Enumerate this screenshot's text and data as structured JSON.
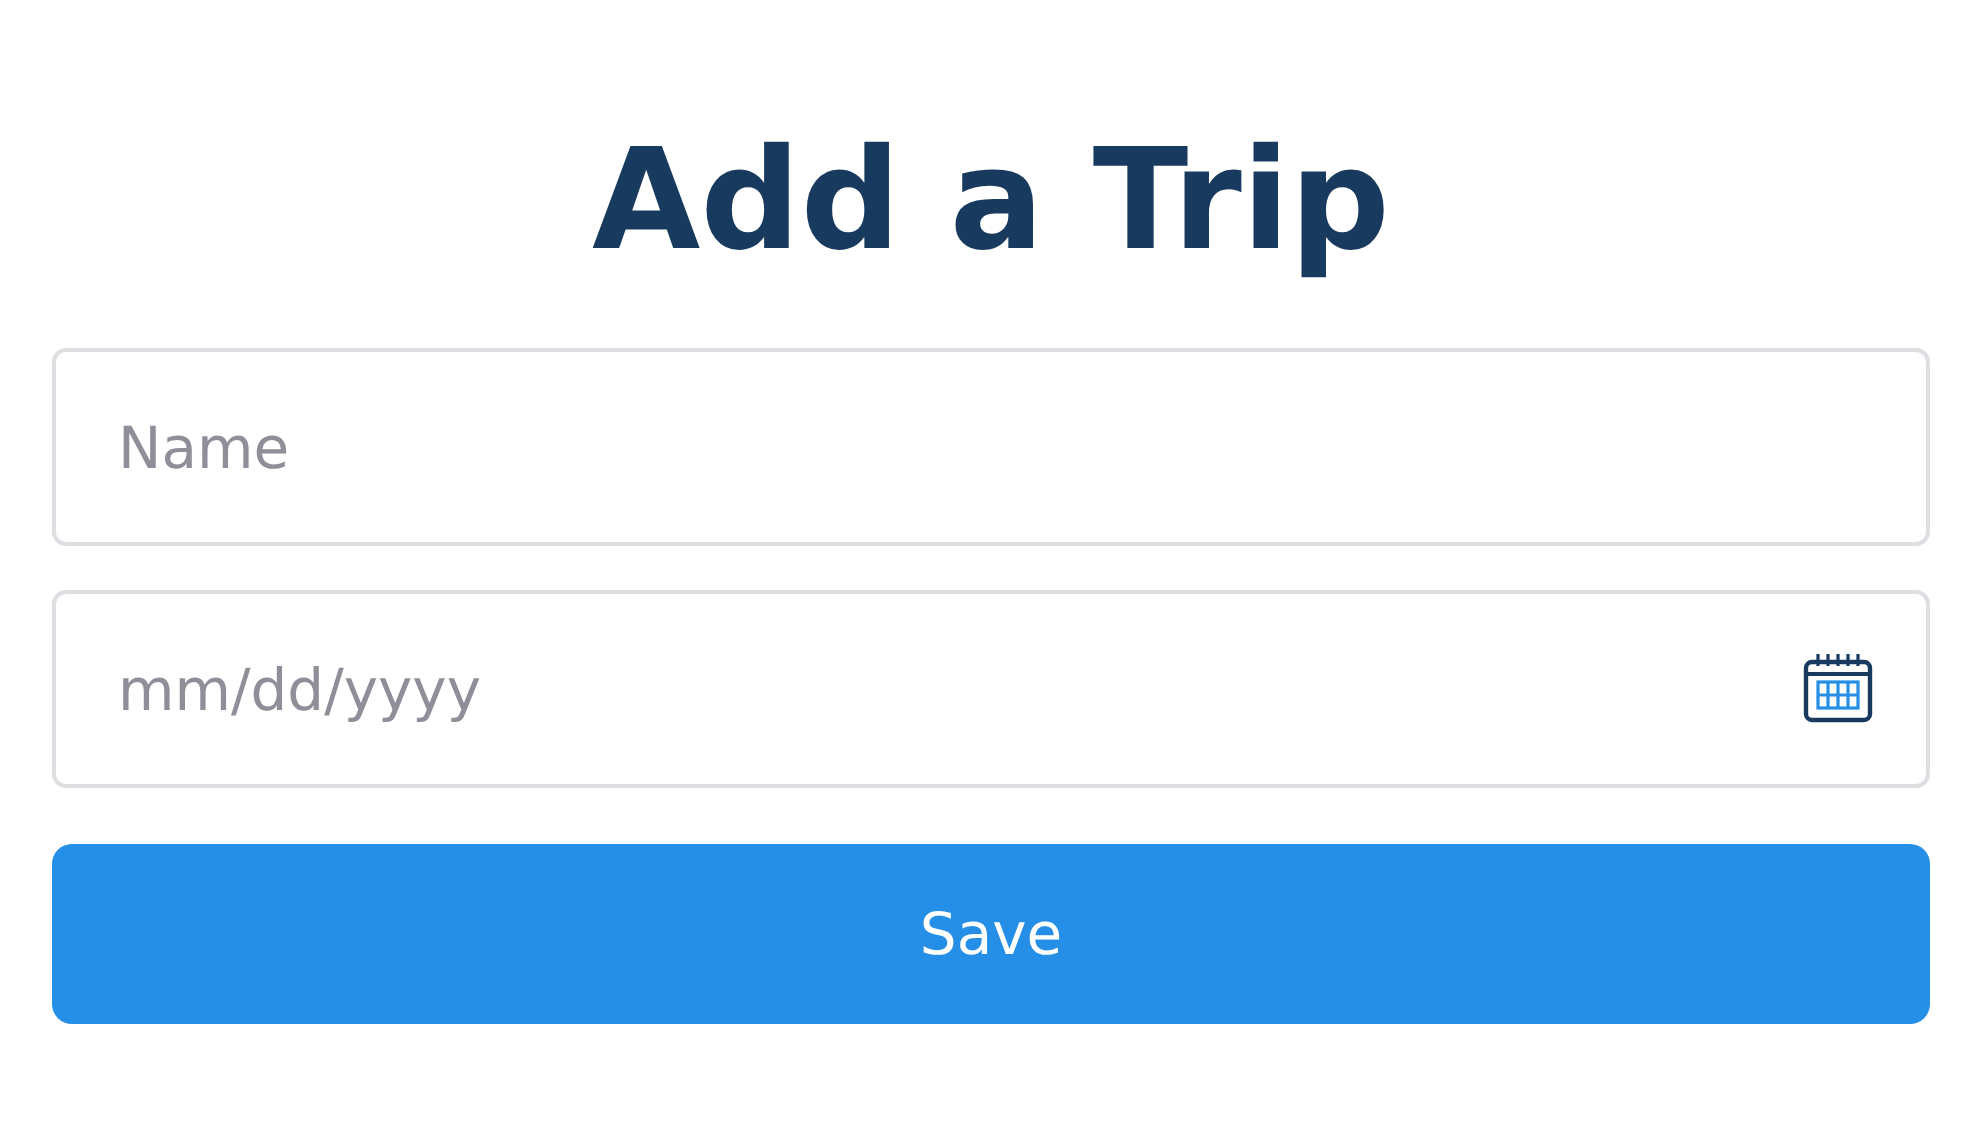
{
  "title": "Add a Trip",
  "fields": [
    {
      "kind": "text",
      "placeholder": "Name"
    },
    {
      "kind": "date",
      "placeholder": "mm/dd/yyyy"
    }
  ],
  "button": {
    "label": "Save"
  }
}
